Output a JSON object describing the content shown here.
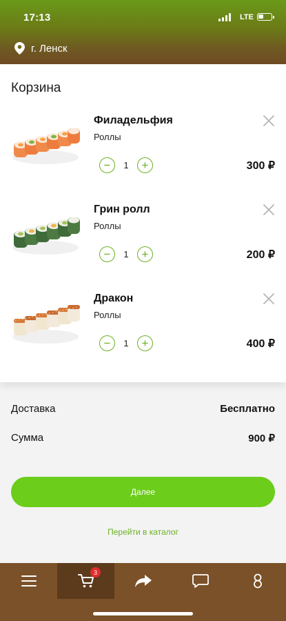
{
  "status": {
    "time": "17:13",
    "network": "LTE"
  },
  "location": {
    "city": "г. Ленск",
    "icon": "map-pin-icon"
  },
  "cart": {
    "title": "Корзина",
    "items": [
      {
        "name": "Филадельфия",
        "category": "Роллы",
        "quantity": "1",
        "price": "300 ₽",
        "image": "philadelphia-roll-image"
      },
      {
        "name": "Грин ролл",
        "category": "Роллы",
        "quantity": "1",
        "price": "200 ₽",
        "image": "green-roll-image"
      },
      {
        "name": "Дракон",
        "category": "Роллы",
        "quantity": "1",
        "price": "400 ₽",
        "image": "dragon-roll-image"
      }
    ]
  },
  "summary": {
    "delivery_label": "Доставка",
    "delivery_value": "Бесплатно",
    "total_label": "Сумма",
    "total_value": "900 ₽"
  },
  "actions": {
    "next_label": "Далее",
    "catalog_link": "Перейти в каталог"
  },
  "bottom_nav": {
    "items": [
      "menu-icon",
      "cart-icon",
      "share-icon",
      "chat-icon",
      "profile-icon"
    ],
    "active": "cart-icon",
    "cart_badge": "3"
  },
  "colors": {
    "accent": "#6ccd1a",
    "header_top": "#6a9a18",
    "header_bottom": "#6f4a24",
    "nav_bg": "#7a5128",
    "badge": "#e32b2b"
  }
}
